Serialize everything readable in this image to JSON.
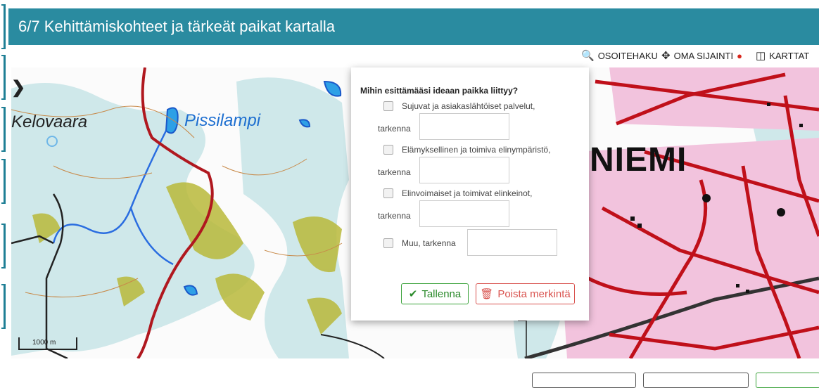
{
  "header": {
    "title": "6/7 Kehittämiskohteet ja tärkeät paikat kartalla"
  },
  "toolbar": {
    "address_search": "OSOITEHAKU",
    "own_location": "OMA SIJAINTI",
    "maps": "KARTTAT"
  },
  "map": {
    "place_1": "Kelovaara",
    "place_2": "Pissilampi",
    "place_3": "NIEMI",
    "scale_label": "1000 m"
  },
  "popup": {
    "question": "Mihin esittämääsi ideaan paikka liittyy?",
    "options": [
      {
        "label": "Sujuvat ja asiakaslähtöiset palvelut,",
        "detail_label": "tarkenna"
      },
      {
        "label": "Elämyksellinen ja toimiva elinympäristö,",
        "detail_label": "tarkenna"
      },
      {
        "label": "Elinvoimaiset ja toimivat elinkeinot,",
        "detail_label": "tarkenna"
      },
      {
        "label": "Muu, tarkenna",
        "detail_label": ""
      }
    ],
    "save_label": "Tallenna",
    "delete_label": "Poista merkintä"
  },
  "colors": {
    "header": "#2a8ba0",
    "save": "#3aa23a",
    "delete": "#d9534f"
  }
}
